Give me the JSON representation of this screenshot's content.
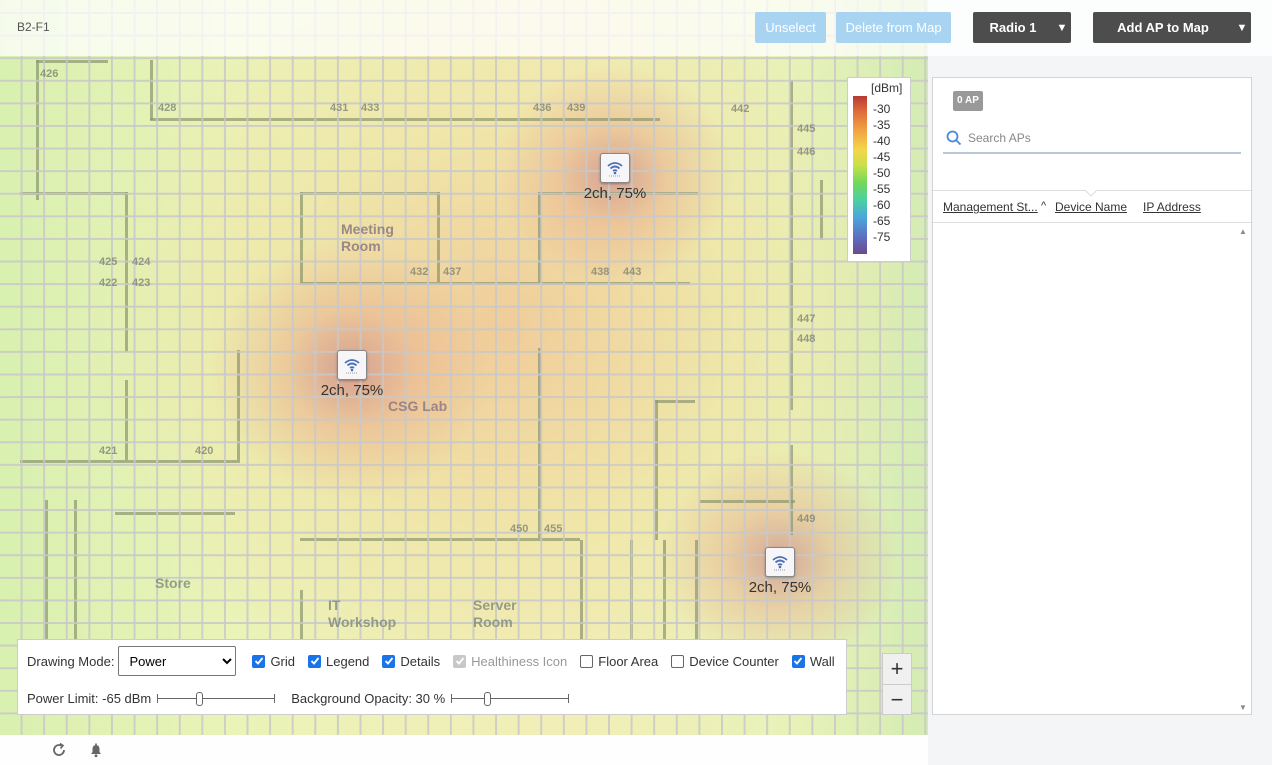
{
  "floor": {
    "name": "B2-F1"
  },
  "toolbar": {
    "unselect_label": "Unselect",
    "delete_label": "Delete from Map",
    "radio_label": "Radio 1",
    "add_ap_label": "Add AP to Map"
  },
  "map": {
    "rooms": {
      "r426": "426",
      "r428": "428",
      "r431": "431",
      "r433": "433",
      "r436": "436",
      "r439": "439",
      "r442": "442",
      "r445": "445",
      "r446": "446",
      "r425": "425",
      "r424": "424",
      "r422": "422",
      "r423": "423",
      "r432": "432",
      "r437": "437",
      "r438": "438",
      "r443": "443",
      "r447": "447",
      "r448": "448",
      "r421": "421",
      "r420": "420",
      "r449": "449",
      "r450": "450",
      "r455": "455"
    },
    "labels": {
      "meeting_room": "Meeting\nRoom",
      "csg_lab": "CSG Lab",
      "store": "Store",
      "it_workshop": "IT\nWorkshop",
      "server_room": "Server\nRoom"
    },
    "aps": [
      {
        "label": "2ch, 75%",
        "icon": "wifi-icon"
      },
      {
        "label": "2ch, 75%",
        "icon": "wifi-icon"
      },
      {
        "label": "2ch, 75%",
        "icon": "wifi-icon"
      }
    ]
  },
  "legend": {
    "unit": "[dBm]",
    "ticks": [
      "-30",
      "-35",
      "-40",
      "-45",
      "-50",
      "-55",
      "-60",
      "-65",
      "-75"
    ]
  },
  "controls": {
    "drawing_mode_label": "Drawing Mode:",
    "drawing_mode_value": "Power",
    "checkboxes": {
      "grid": "Grid",
      "legend": "Legend",
      "details": "Details",
      "healthiness": "Healthiness Icon",
      "floor_area": "Floor Area",
      "device_counter": "Device Counter",
      "wall": "Wall"
    },
    "power_limit_label": "Power Limit: -65 dBm",
    "power_limit_fraction": 0.35,
    "bg_opacity_label": "Background Opacity: 30 %",
    "bg_opacity_fraction": 0.3
  },
  "zoom": {
    "in": "+",
    "out": "−"
  },
  "bottombar": {
    "icons": [
      "refresh-icon",
      "bell-icon"
    ]
  },
  "panel": {
    "ap_count": "0 AP",
    "search_placeholder": "Search APs",
    "columns": {
      "mgmt": "Management St...",
      "device": "Device Name",
      "ip": "IP Address"
    },
    "sort_indicator": "^"
  },
  "colors": {
    "accent_blue": "#1a73e8",
    "button_light": "#a8d4f2",
    "button_dark": "#4d4d4d"
  }
}
